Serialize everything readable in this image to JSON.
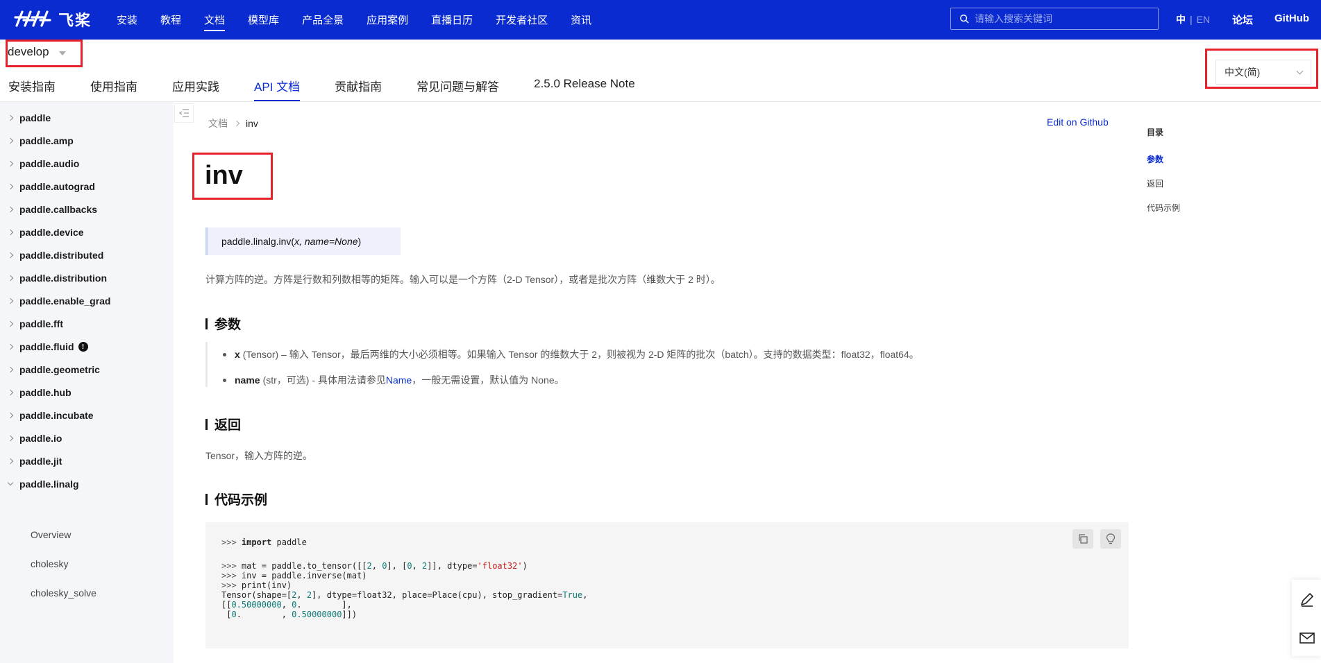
{
  "topnav": {
    "logo_text": "飞桨",
    "items": [
      "安装",
      "教程",
      "文档",
      "模型库",
      "产品全景",
      "应用案例",
      "直播日历",
      "开发者社区",
      "资讯"
    ],
    "active_index": 2,
    "search_placeholder": "请输入搜索关键词",
    "lang_zh": "中",
    "lang_sep": "|",
    "lang_en": "EN",
    "forum": "论坛",
    "github": "GitHub"
  },
  "version": {
    "label": "develop"
  },
  "subtabs": {
    "items": [
      "安装指南",
      "使用指南",
      "应用实践",
      "API 文档",
      "贡献指南",
      "常见问题与解答",
      "2.5.0 Release Note"
    ],
    "active_index": 3
  },
  "language_select": {
    "value": "中文(简)"
  },
  "sidebar": {
    "items": [
      {
        "label": "paddle"
      },
      {
        "label": "paddle.amp"
      },
      {
        "label": "paddle.audio"
      },
      {
        "label": "paddle.autograd"
      },
      {
        "label": "paddle.callbacks"
      },
      {
        "label": "paddle.device"
      },
      {
        "label": "paddle.distributed"
      },
      {
        "label": "paddle.distribution"
      },
      {
        "label": "paddle.enable_grad"
      },
      {
        "label": "paddle.fft"
      },
      {
        "label": "paddle.fluid",
        "badge": "!"
      },
      {
        "label": "paddle.geometric"
      },
      {
        "label": "paddle.hub"
      },
      {
        "label": "paddle.incubate"
      },
      {
        "label": "paddle.io"
      },
      {
        "label": "paddle.jit"
      },
      {
        "label": "paddle.linalg",
        "open": true
      }
    ],
    "sub_items": [
      "Overview",
      "cholesky",
      "cholesky_solve"
    ]
  },
  "breadcrumb": {
    "root": "文档",
    "current": "inv"
  },
  "edit_link": "Edit on Github",
  "page": {
    "title": "inv",
    "signature_prefix": "paddle.linalg.inv(",
    "signature_args": "x, name=None",
    "signature_suffix": ")",
    "description": "计算方阵的逆。方阵是行数和列数相等的矩阵。输入可以是一个方阵（2-D Tensor），或者是批次方阵（维数大于 2 时）。",
    "params_heading": "参数",
    "params": [
      {
        "name": "x",
        "text": "(Tensor) – 输入 Tensor，最后两维的大小必须相等。如果输入 Tensor 的维数大于 2，则被视为 2-D 矩阵的批次（batch）。支持的数据类型：float32，float64。"
      },
      {
        "name": "name",
        "text_before": "(str，可选) - 具体用法请参见 ",
        "link": "Name",
        "text_after": "，一般无需设置，默认值为 None。"
      }
    ],
    "returns_heading": "返回",
    "returns_text": "Tensor，输入方阵的逆。",
    "example_heading": "代码示例"
  },
  "toc": {
    "heading": "目录",
    "items": [
      "参数",
      "返回",
      "代码示例"
    ],
    "active_index": 0
  },
  "code": {
    "lines": [
      ">>> import paddle",
      "",
      ">>> mat = paddle.to_tensor([[2, 0], [0, 2]], dtype='float32')",
      ">>> inv = paddle.inverse(mat)",
      ">>> print(inv)",
      "Tensor(shape=[2, 2], dtype=float32, place=Place(cpu), stop_gradient=True,",
      "[[0.50000000, 0.        ],",
      " [0.        , 0.50000000]])"
    ]
  },
  "colors": {
    "brand": "#0a2bcf",
    "highlight": "#e8222b"
  }
}
